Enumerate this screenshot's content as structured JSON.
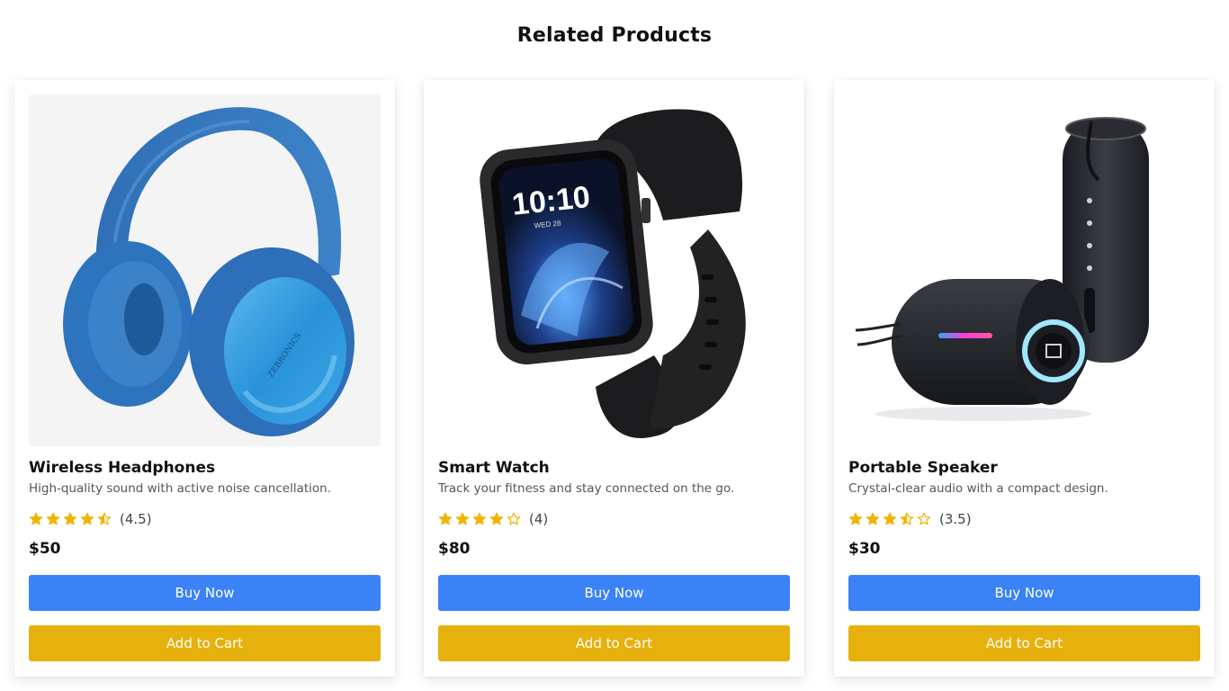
{
  "page": {
    "title": "Related Products"
  },
  "colors": {
    "buy": "#3b82f6",
    "cart": "#e6b10c",
    "star": "#f0b400"
  },
  "products": [
    {
      "name": "Wireless Headphones",
      "description": "High-quality sound with active noise cancellation.",
      "rating": 4.5,
      "rating_text": "(4.5)",
      "price": "$50",
      "image": "headphones-image",
      "buy_label": "Buy Now",
      "cart_label": "Add to Cart"
    },
    {
      "name": "Smart Watch",
      "description": "Track your fitness and stay connected on the go.",
      "rating": 4,
      "rating_text": "(4)",
      "price": "$80",
      "image": "smart-watch-image",
      "buy_label": "Buy Now",
      "cart_label": "Add to Cart"
    },
    {
      "name": "Portable Speaker",
      "description": "Crystal-clear audio with a compact design.",
      "rating": 3.5,
      "rating_text": "(3.5)",
      "price": "$30",
      "image": "portable-speaker-image",
      "buy_label": "Buy Now",
      "cart_label": "Add to Cart"
    }
  ]
}
